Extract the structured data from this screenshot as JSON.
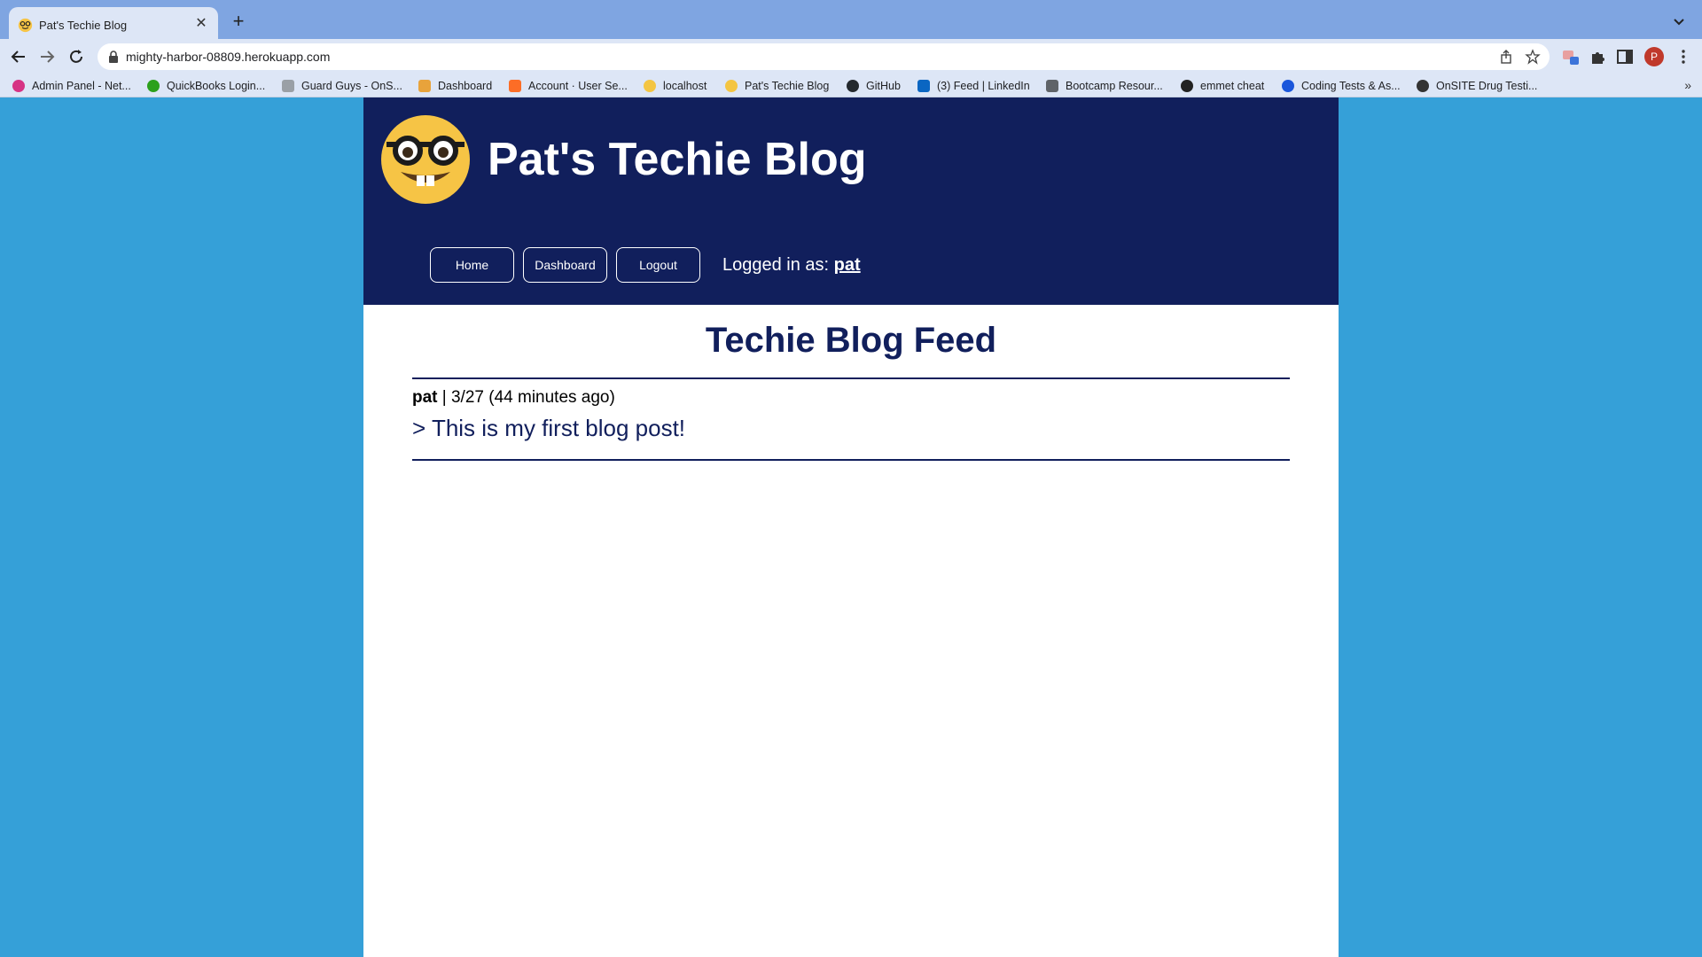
{
  "browser": {
    "tab": {
      "title": "Pat's Techie Blog"
    },
    "address_bar": {
      "url": "mighty-harbor-08809.herokuapp.com"
    },
    "profile_initial": "P",
    "bookmarks": [
      {
        "label": "Admin Panel - Net...",
        "color": "#d63384"
      },
      {
        "label": "QuickBooks Login...",
        "color": "#2ca01c"
      },
      {
        "label": "Guard Guys - OnS...",
        "color": "#9aa0a6"
      },
      {
        "label": "Dashboard",
        "color": "#e8a33b"
      },
      {
        "label": "Account · User Se...",
        "color": "#fc6d26"
      },
      {
        "label": "localhost",
        "color": "#f4c542"
      },
      {
        "label": "Pat's Techie Blog",
        "color": "#f4c542"
      },
      {
        "label": "GitHub",
        "color": "#24292e"
      },
      {
        "label": "(3) Feed | LinkedIn",
        "color": "#0a66c2"
      },
      {
        "label": "Bootcamp Resour...",
        "color": "#5f6368"
      },
      {
        "label": "emmet cheat",
        "color": "#222222"
      },
      {
        "label": "Coding Tests & As...",
        "color": "#1a56db"
      },
      {
        "label": "OnSITE Drug Testi...",
        "color": "#333333"
      }
    ]
  },
  "site": {
    "title": "Pat's Techie Blog",
    "nav": {
      "home": "Home",
      "dashboard": "Dashboard",
      "logout": "Logout"
    },
    "logged_in_label": "Logged in as:",
    "username": "pat"
  },
  "feed": {
    "title": "Techie Blog Feed",
    "posts": [
      {
        "author": "pat",
        "meta": " | 3/27 (44 minutes ago)",
        "title": "> This is my first blog post!"
      }
    ]
  },
  "colors": {
    "page_background": "#35a0d8",
    "header_background": "#111f5c",
    "accent": "#111f5c"
  }
}
